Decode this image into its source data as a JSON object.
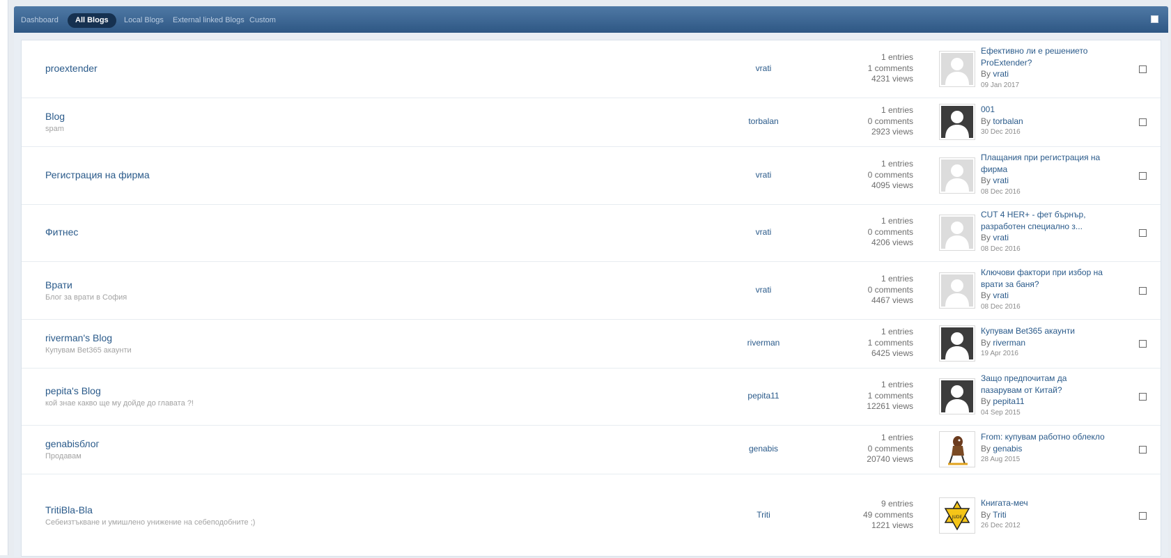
{
  "tabs": [
    "Dashboard",
    "All Blogs",
    "Local Blogs",
    "External linked Blogs",
    "Custom"
  ],
  "active_tab": "All Blogs",
  "by_label": "By",
  "blogs": [
    {
      "name": "proextender",
      "desc": "",
      "author": "vrati",
      "entries": "1 entries",
      "comments": "1 comments",
      "views": "4231 views",
      "avatar": "default-avatar-light",
      "last_title_1": "Ефективно ли е решението",
      "last_title_2": "ProExtender?",
      "last_author": "vrati",
      "last_date": "09 Jan 2017"
    },
    {
      "name": "Blog",
      "desc": "spam",
      "author": "torbalan",
      "entries": "1 entries",
      "comments": "0 comments",
      "views": "2923 views",
      "avatar": "default-avatar-dark",
      "last_title_1": "001",
      "last_title_2": "",
      "last_author": "torbalan",
      "last_date": "30 Dec 2016"
    },
    {
      "name": "Регистрация на фирма",
      "desc": "",
      "author": "vrati",
      "entries": "1 entries",
      "comments": "0 comments",
      "views": "4095 views",
      "avatar": "default-avatar-light",
      "last_title_1": "Плащания при регистрация на",
      "last_title_2": "фирма",
      "last_author": "vrati",
      "last_date": "08 Dec 2016"
    },
    {
      "name": "Фитнес",
      "desc": "",
      "author": "vrati",
      "entries": "1 entries",
      "comments": "0 comments",
      "views": "4206 views",
      "avatar": "default-avatar-light",
      "last_title_1": "CUT 4 HER+ - фет бърнър,",
      "last_title_2": "разработен специално з...",
      "last_author": "vrati",
      "last_date": "08 Dec 2016"
    },
    {
      "name": "Врати",
      "desc": "Блог за врати в София",
      "author": "vrati",
      "entries": "1 entries",
      "comments": "0 comments",
      "views": "4467 views",
      "avatar": "default-avatar-light",
      "last_title_1": "Ключови фактори при избор на",
      "last_title_2": "врати за баня?",
      "last_author": "vrati",
      "last_date": "08 Dec 2016"
    },
    {
      "name": "riverman's Blog",
      "desc": "Купувам Bet365 акаунти",
      "author": "riverman",
      "entries": "1 entries",
      "comments": "1 comments",
      "views": "6425 views",
      "avatar": "default-avatar-dark",
      "last_title_1": "Купувам Bet365 акаунти",
      "last_title_2": "",
      "last_author": "riverman",
      "last_date": "19 Apr 2016"
    },
    {
      "name": "pepita's Blog",
      "desc": "кой знае какво ще му дойде до главата ?!",
      "author": "pepita11",
      "entries": "1 entries",
      "comments": "1 comments",
      "views": "12261 views",
      "avatar": "default-avatar-dark",
      "last_title_1": "Защо предпочитам да",
      "last_title_2": "пазарувам от Китай?",
      "last_author": "pepita11",
      "last_date": "04 Sep 2015"
    },
    {
      "name": "genabisблог",
      "desc": "Продавам",
      "author": "genabis",
      "entries": "1 entries",
      "comments": "0 comments",
      "views": "20740 views",
      "avatar": "cartoon-figure",
      "last_title_1": "From: купувам работно облекло",
      "last_title_2": "",
      "last_author": "genabis",
      "last_date": "28 Aug 2015"
    },
    {
      "name": "TritiBla-Bla",
      "desc": "Себеизтъкване и умишлено унижение на себеподобните ;)",
      "author": "Triti",
      "entries": "9 entries",
      "comments": "49 comments",
      "views": "1221 views",
      "avatar": "yellow-star",
      "last_title_1": "Книгата-меч",
      "last_title_2": "",
      "last_author": "Triti",
      "last_date": "26 Dec 2012"
    }
  ]
}
